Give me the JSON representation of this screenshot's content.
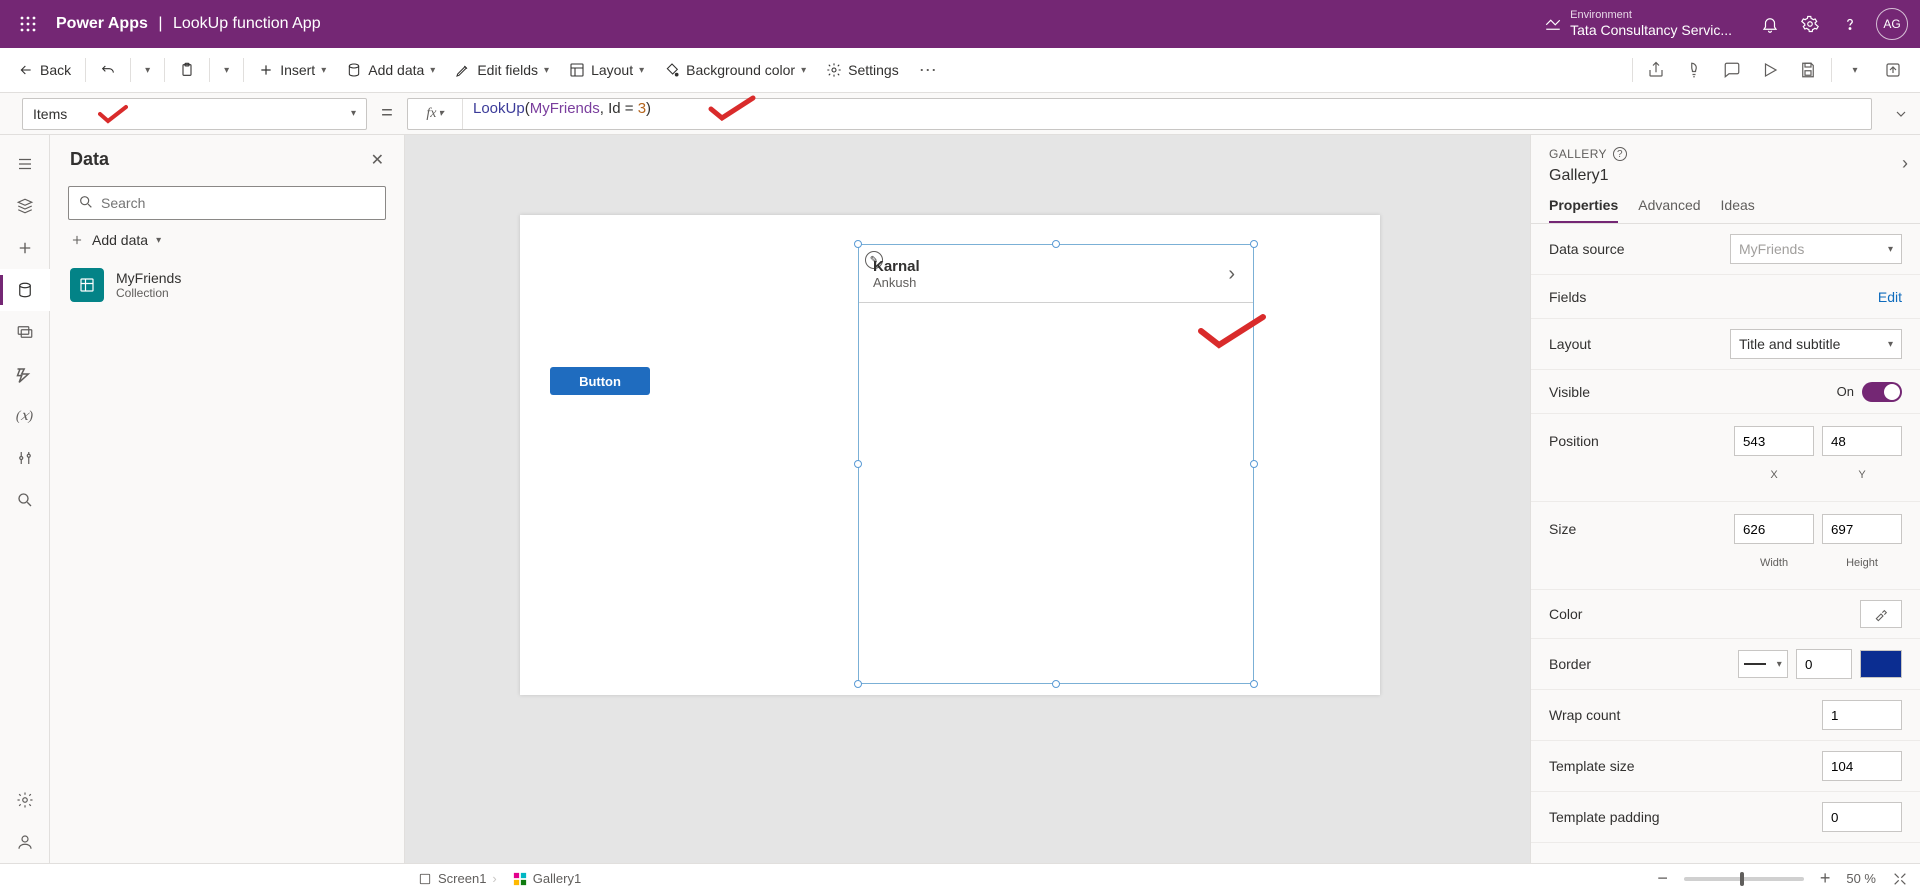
{
  "header": {
    "appName": "Power Apps",
    "separator": "|",
    "fileName": "LookUp function App",
    "envLabel": "Environment",
    "envName": "Tata Consultancy Servic...",
    "avatar": "AG"
  },
  "cmdbar": {
    "back": "Back",
    "insert": "Insert",
    "addData": "Add data",
    "editFields": "Edit fields",
    "layout": "Layout",
    "bgColor": "Background color",
    "settings": "Settings"
  },
  "formula": {
    "property": "Items",
    "fn": "LookUp",
    "arg1": "MyFriends",
    "arg2": "Id",
    "op": "=",
    "val": "3"
  },
  "datapane": {
    "title": "Data",
    "searchPlaceholder": "Search",
    "addData": "Add data",
    "items": [
      {
        "name": "MyFriends",
        "type": "Collection"
      }
    ]
  },
  "canvas": {
    "buttonLabel": "Button",
    "rowTitle": "Karnal",
    "rowSubtitle": "Ankush"
  },
  "props": {
    "category": "GALLERY",
    "name": "Gallery1",
    "tabs": {
      "p": "Properties",
      "a": "Advanced",
      "i": "Ideas"
    },
    "dataSourceLabel": "Data source",
    "dataSourceValue": "MyFriends",
    "fieldsLabel": "Fields",
    "fieldsEdit": "Edit",
    "layoutLabel": "Layout",
    "layoutValue": "Title and subtitle",
    "visibleLabel": "Visible",
    "visibleOn": "On",
    "positionLabel": "Position",
    "posX": "543",
    "posY": "48",
    "xLabel": "X",
    "yLabel": "Y",
    "sizeLabel": "Size",
    "width": "626",
    "height": "697",
    "wLabel": "Width",
    "hLabel": "Height",
    "colorLabel": "Color",
    "borderLabel": "Border",
    "borderVal": "0",
    "wrapLabel": "Wrap count",
    "wrapVal": "1",
    "tplSizeLabel": "Template size",
    "tplSizeVal": "104",
    "tplPadLabel": "Template padding",
    "tplPadVal": "0"
  },
  "status": {
    "screen": "Screen1",
    "gallery": "Gallery1",
    "zoom": "50  %"
  }
}
